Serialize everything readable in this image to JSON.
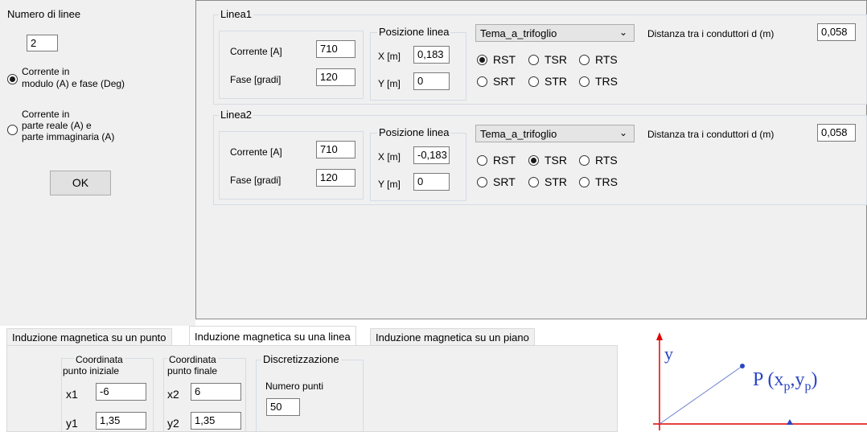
{
  "left": {
    "num_lines_label": "Numero di linee",
    "num_lines_value": "2",
    "mode1_line1": "Corrente in",
    "mode1_line2": "modulo (A) e fase (Deg)",
    "mode2_line1": "Corrente in",
    "mode2_line2": "parte reale (A) e",
    "mode2_line3": "parte immaginaria (A)",
    "mode_selected": 1,
    "ok_label": "OK"
  },
  "lines": [
    {
      "title": "Linea1",
      "corrente_label": "Corrente [A]",
      "corrente_value": "710",
      "fase_label": "Fase [gradi]",
      "fase_value": "120",
      "pos_title": "Posizione linea",
      "x_label": "X [m]",
      "x_value": "0,183",
      "y_label": "Y [m]",
      "y_value": "0",
      "config_value": "Tema_a_trifoglio",
      "phases": [
        "RST",
        "TSR",
        "RTS",
        "SRT",
        "STR",
        "TRS"
      ],
      "phase_selected": "RST",
      "dist_label": "Distanza tra i conduttori d (m)",
      "dist_value": "0,058"
    },
    {
      "title": "Linea2",
      "corrente_label": "Corrente [A]",
      "corrente_value": "710",
      "fase_label": "Fase [gradi]",
      "fase_value": "120",
      "pos_title": "Posizione linea",
      "x_label": "X [m]",
      "x_value": "-0,183",
      "y_label": "Y [m]",
      "y_value": "0",
      "config_value": "Tema_a_trifoglio",
      "phases": [
        "RST",
        "TSR",
        "RTS",
        "SRT",
        "STR",
        "TRS"
      ],
      "phase_selected": "TSR",
      "dist_label": "Distanza tra i conduttori d (m)",
      "dist_value": "0,058"
    }
  ],
  "tabs": [
    {
      "label": "Induzione magnetica su un punto",
      "active": false
    },
    {
      "label": "Induzione magnetica su una linea",
      "active": true
    },
    {
      "label": "Induzione magnetica su un piano",
      "active": false
    }
  ],
  "tab_content": {
    "start_title_1": "Coordinata",
    "start_title_2": "punto iniziale",
    "end_title_1": "Coordinata",
    "end_title_2": "punto finale",
    "x1_label": "x1",
    "x1_value": "-6",
    "y1_label": "y1",
    "y1_value": "1,35",
    "x2_label": "x2",
    "x2_value": "6",
    "y2_label": "y2",
    "y2_value": "1,35",
    "disc_title": "Discretizzazione",
    "num_points_label": "Numero punti",
    "num_points_value": "50"
  },
  "diagram": {
    "y_axis_label": "y",
    "point_label": "P (x",
    "sub_p": "p",
    "comma": ",y",
    "close": ")",
    "axis_color": "#e00000",
    "line_color": "#6a7fd0"
  }
}
